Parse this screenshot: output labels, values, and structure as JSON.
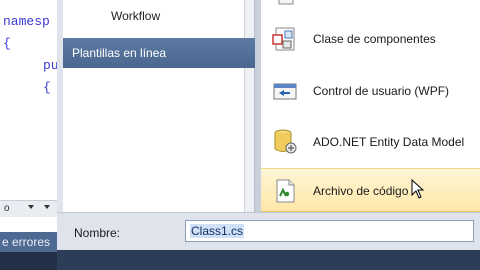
{
  "editor": {
    "lines": [
      "namesp",
      "{",
      "pu",
      "{"
    ],
    "scroll_value": "o",
    "errors_tab": "e errores"
  },
  "dialog": {
    "tree": {
      "workflow_label": "Workflow",
      "online_templates_label": "Plantillas en línea"
    },
    "templates": [
      {
        "label": "Clase de componentes",
        "icon": "component-class-icon"
      },
      {
        "label": "Control de usuario (WPF)",
        "icon": "wpf-user-control-icon"
      },
      {
        "label": "ADO.NET Entity Data Model",
        "icon": "entity-data-model-icon"
      },
      {
        "label": "Archivo de código",
        "icon": "code-file-icon"
      }
    ],
    "selected_template": "Archivo de código",
    "name_label": "Nombre:",
    "name_value": "Class1.cs"
  },
  "colors": {
    "selection": "#ffe7a8",
    "online_header": "#4a6790"
  }
}
